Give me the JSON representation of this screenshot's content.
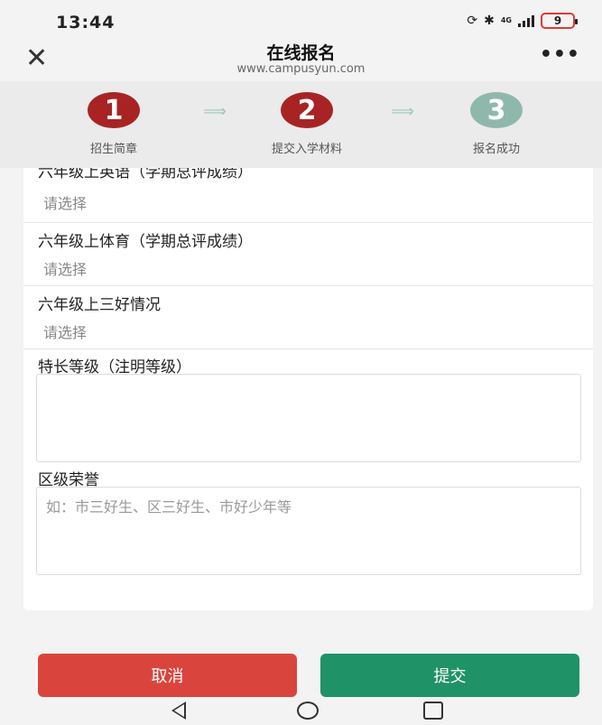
{
  "status": {
    "time": "13:44",
    "network": "4G",
    "battery": "9"
  },
  "header": {
    "title": "在线报名",
    "subtitle": "www.campusyun.com"
  },
  "steps": [
    {
      "number": "1",
      "label": "招生简章",
      "state": "done"
    },
    {
      "number": "2",
      "label": "提交入学材料",
      "state": "current"
    },
    {
      "number": "3",
      "label": "报名成功",
      "state": "todo"
    }
  ],
  "form": {
    "field_english": {
      "label": "六年级上英语（学期总评成绩）",
      "value": "请选择"
    },
    "field_pe": {
      "label": "六年级上体育（学期总评成绩）",
      "value": "请选择"
    },
    "field_sanhao": {
      "label": "六年级上三好情况",
      "value": "请选择"
    },
    "field_specialty": {
      "label": "特长等级（注明等级）",
      "placeholder": ""
    },
    "field_honor": {
      "label": "区级荣誉",
      "placeholder": "如：市三好生、区三好生、市好少年等"
    }
  },
  "buttons": {
    "cancel": "取消",
    "submit": "提交"
  },
  "colors": {
    "cancel": "#d9453d",
    "submit": "#209267",
    "step_done": "#a82424",
    "step_todo": "#8fb8ac"
  },
  "icons": {
    "close": "close-icon",
    "more": "more-icon",
    "back": "nav-back-icon",
    "home": "nav-home-icon",
    "recent": "nav-recent-icon"
  }
}
